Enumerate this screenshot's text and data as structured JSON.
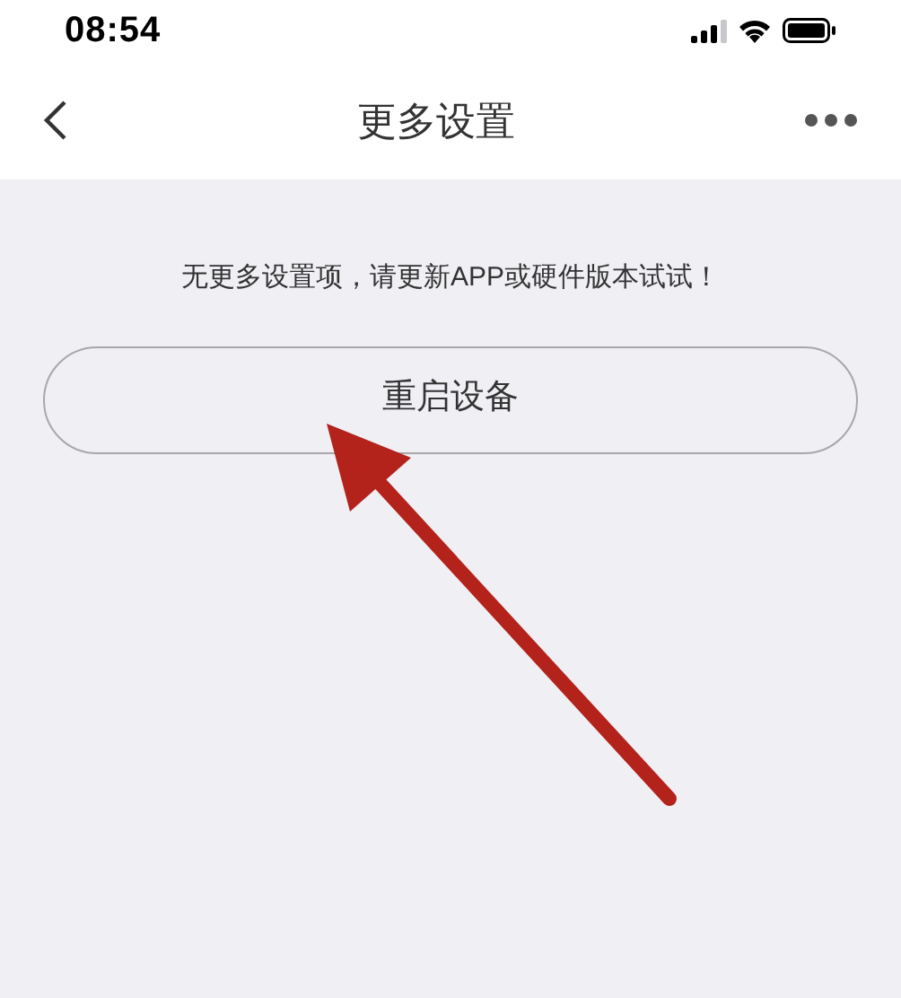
{
  "status_bar": {
    "time": "08:54"
  },
  "nav_bar": {
    "title": "更多设置"
  },
  "message": "无更多设置项，请更新APP或硬件版本试试！",
  "buttons": [
    {
      "label": "重启设备"
    }
  ]
}
